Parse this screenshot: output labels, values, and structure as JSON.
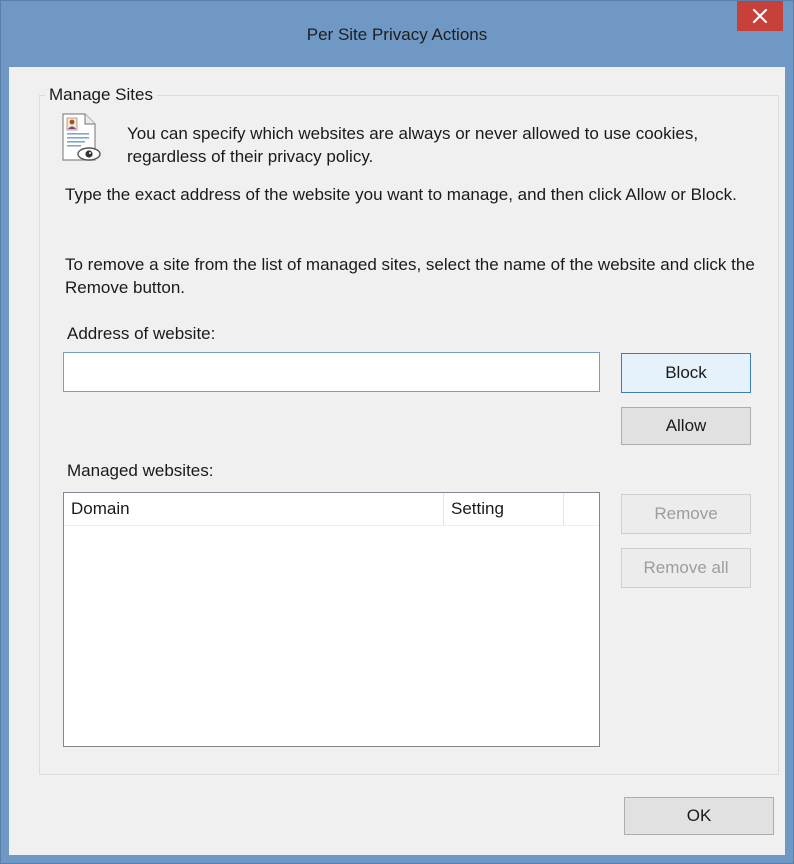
{
  "window": {
    "title": "Per Site Privacy Actions",
    "close_icon": "close-icon",
    "colors": {
      "titlebar": "#6f98c5",
      "close_button": "#c7403a",
      "client": "#f0f0f0"
    }
  },
  "group": {
    "legend": "Manage Sites",
    "icon": "privacy-document-icon",
    "intro": "You can specify which websites are always or never allowed to use cookies, regardless of their privacy policy.",
    "instructions": "Type the exact address of the website you want to manage, and then click Allow or Block.",
    "remove_instructions": "To remove a site from the list of managed sites, select the name of the website and click the Remove button."
  },
  "address": {
    "label": "Address of website:",
    "value": "",
    "placeholder": ""
  },
  "buttons": {
    "block": "Block",
    "allow": "Allow",
    "remove": "Remove",
    "remove_all": "Remove all",
    "ok": "OK"
  },
  "managed": {
    "label": "Managed websites:",
    "columns": [
      "Domain",
      "Setting"
    ],
    "rows": []
  }
}
